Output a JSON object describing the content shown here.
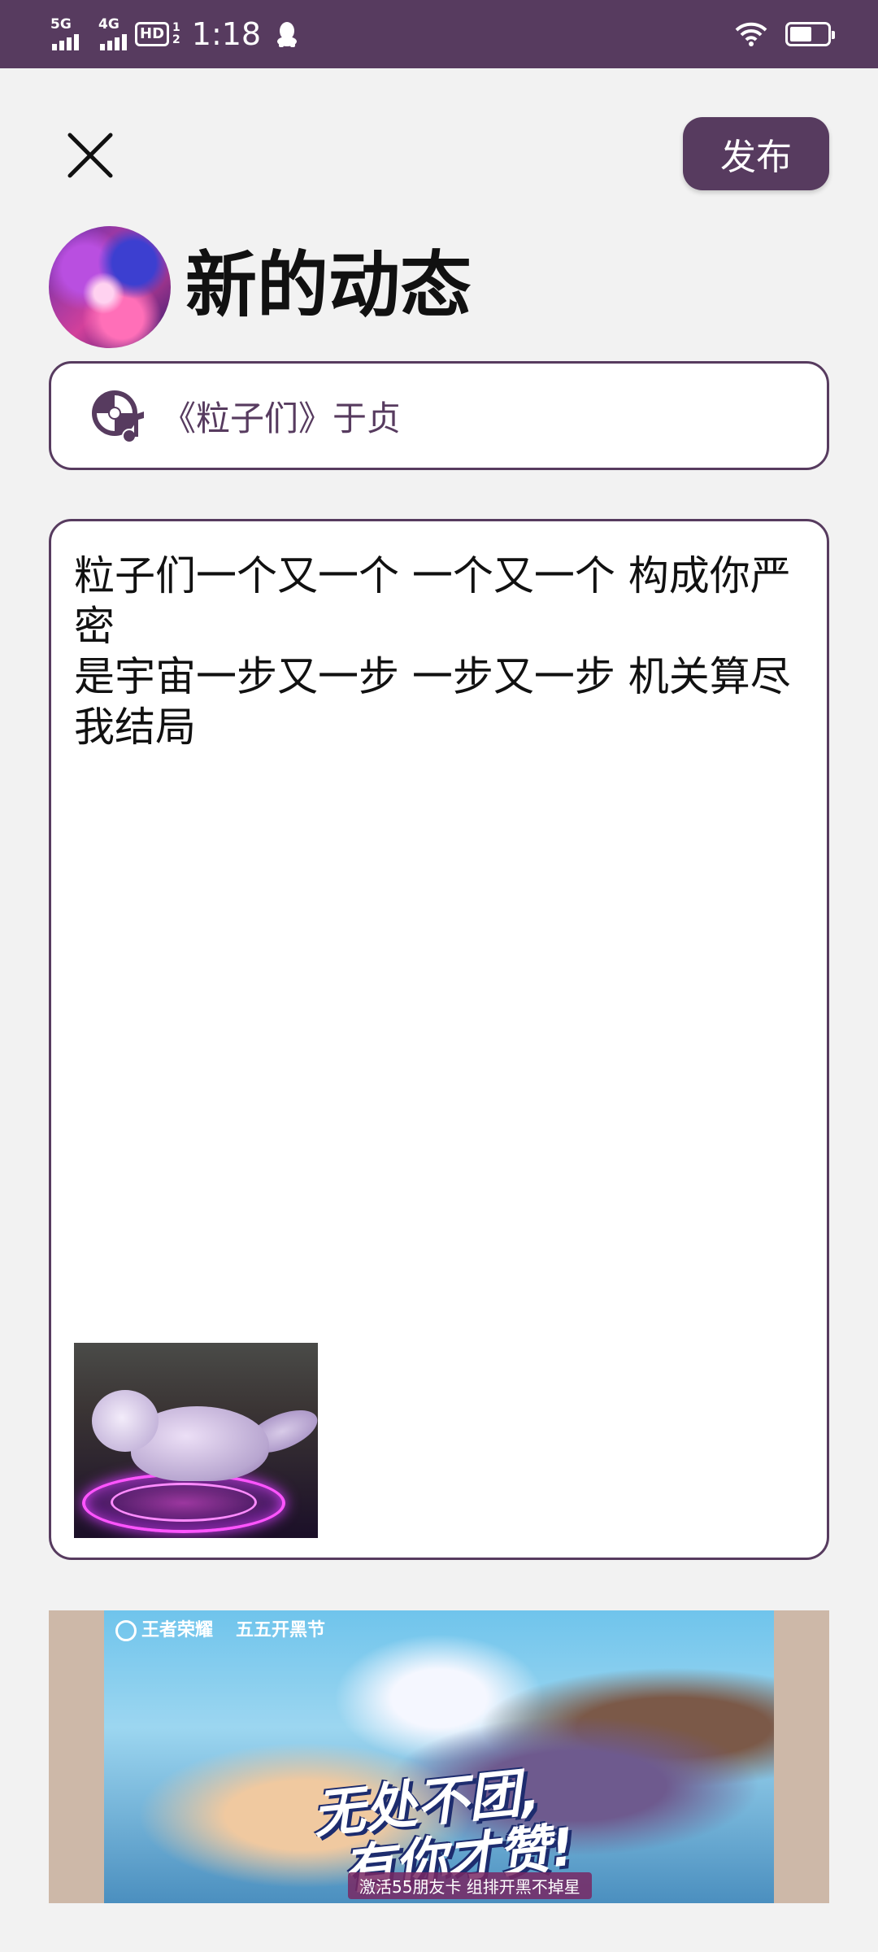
{
  "status_bar": {
    "net1": "5G",
    "net2": "4G",
    "hd_label": "HD",
    "hd_sub_top": "1",
    "hd_sub_bottom": "2",
    "time": "1:18",
    "battery_level": 0.6
  },
  "header": {
    "publish_label": "发布",
    "title": "新的动态"
  },
  "music": {
    "label": "《粒子们》于贞"
  },
  "post": {
    "text": "粒子们一个又一个 一个又一个 构成你严密\n是宇宙一步又一步 一步又一步 机关算尽 我结局"
  },
  "ad": {
    "brand1": "王者荣耀",
    "brand2": "五五开黑节",
    "slogan_line1": "无处不团,",
    "slogan_line2": "有你才赞!",
    "sub": "激活55朋友卡 组排开黑不掉星"
  },
  "colors": {
    "accent": "#573b5f",
    "background": "#f2f2f2"
  }
}
